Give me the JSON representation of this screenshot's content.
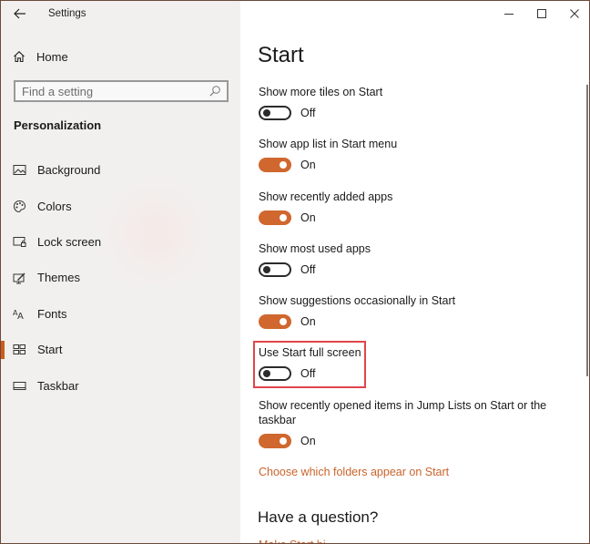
{
  "app": {
    "title": "Settings"
  },
  "window_controls": {
    "minimize": "minimize-icon",
    "maximize": "maximize-icon",
    "close": "close-icon"
  },
  "sidebar": {
    "home_label": "Home",
    "search_placeholder": "Find a setting",
    "search_value": "",
    "section_title": "Personalization",
    "items": [
      {
        "label": "Background",
        "icon": "picture-icon",
        "active": false
      },
      {
        "label": "Colors",
        "icon": "palette-icon",
        "active": false
      },
      {
        "label": "Lock screen",
        "icon": "lock-screen-icon",
        "active": false
      },
      {
        "label": "Themes",
        "icon": "themes-icon",
        "active": false
      },
      {
        "label": "Fonts",
        "icon": "fonts-icon",
        "active": false
      },
      {
        "label": "Start",
        "icon": "start-tiles-icon",
        "active": true
      },
      {
        "label": "Taskbar",
        "icon": "taskbar-icon",
        "active": false
      }
    ]
  },
  "main": {
    "title": "Start",
    "settings": [
      {
        "label": "Show more tiles on Start",
        "state": "Off",
        "on": false
      },
      {
        "label": "Show app list in Start menu",
        "state": "On",
        "on": true
      },
      {
        "label": "Show recently added apps",
        "state": "On",
        "on": true
      },
      {
        "label": "Show most used apps",
        "state": "Off",
        "on": false
      },
      {
        "label": "Show suggestions occasionally in Start",
        "state": "On",
        "on": true
      },
      {
        "label": "Use Start full screen",
        "state": "Off",
        "on": false,
        "highlighted": true
      },
      {
        "label": "Show recently opened items in Jump Lists on Start or the taskbar",
        "state": "On",
        "on": true
      }
    ],
    "folders_link": "Choose which folders appear on Start",
    "question_heading": "Have a question?",
    "help_link_partial": "Make Start bi..."
  },
  "colors": {
    "accent": "#d0672e",
    "link": "#c9642c",
    "highlight_box": "#e0454b",
    "active_indicator": "#cc5c1a"
  }
}
